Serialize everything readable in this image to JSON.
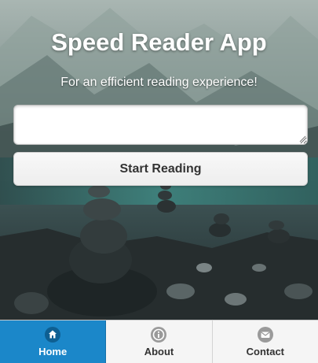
{
  "app": {
    "title": "Speed Reader App",
    "subtitle": "For an efficient reading experience!"
  },
  "reader": {
    "input_value": "",
    "input_placeholder": "",
    "start_button_label": "Start Reading"
  },
  "navbar": {
    "items": [
      {
        "label": "Home",
        "icon": "home-icon",
        "active": true
      },
      {
        "label": "About",
        "icon": "info-icon",
        "active": false
      },
      {
        "label": "Contact",
        "icon": "mail-icon",
        "active": false
      }
    ]
  },
  "colors": {
    "nav_active": "#1b87c9",
    "nav_inactive": "#f5f5f5",
    "button_bg": "#f4f4f4",
    "text_dark": "#333333"
  }
}
